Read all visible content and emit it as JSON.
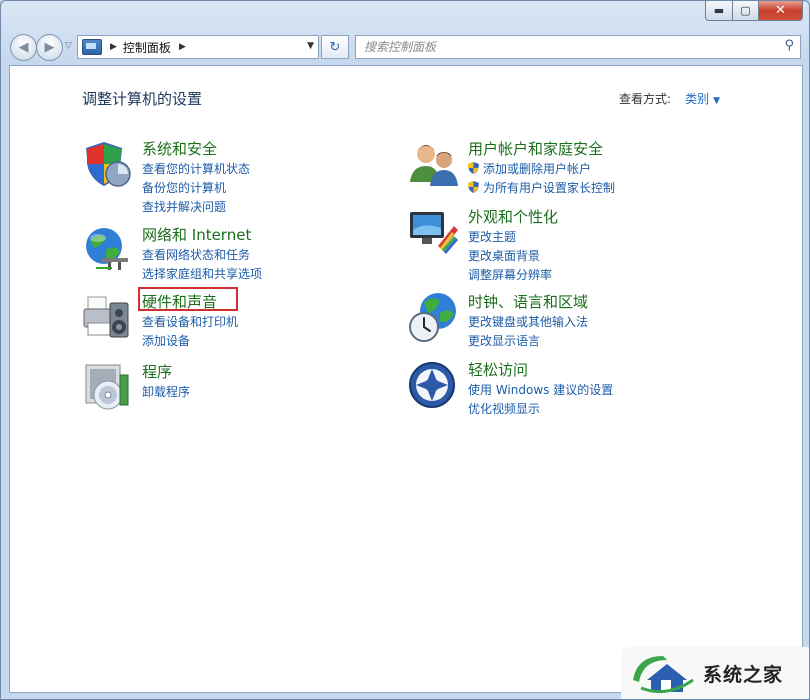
{
  "window": {
    "minimize_label": "▬",
    "maximize_label": "▢",
    "close_label": "✕"
  },
  "nav": {
    "address_crumb": "控制面板",
    "search_placeholder": "搜索控制面板"
  },
  "header": {
    "title": "调整计算机的设置",
    "view_by_label": "查看方式:",
    "view_by_value": "类别"
  },
  "categories_left": [
    {
      "title": "系统和安全",
      "icon": "shield-icon",
      "links": [
        "查看您的计算机状态",
        "备份您的计算机",
        "查找并解决问题"
      ]
    },
    {
      "title": "网络和 Internet",
      "icon": "network-globe-icon",
      "links": [
        "查看网络状态和任务",
        "选择家庭组和共享选项"
      ]
    },
    {
      "title": "硬件和声音",
      "icon": "printer-speaker-icon",
      "links": [
        "查看设备和打印机",
        "添加设备"
      ]
    },
    {
      "title": "程序",
      "icon": "programs-disc-icon",
      "links": [
        "卸载程序"
      ]
    }
  ],
  "categories_right": [
    {
      "title": "用户帐户和家庭安全",
      "icon": "users-icon",
      "links": [
        "添加或删除用户帐户",
        "为所有用户设置家长控制"
      ]
    },
    {
      "title": "外观和个性化",
      "icon": "monitor-paint-icon",
      "links": [
        "更改主题",
        "更改桌面背景",
        "调整屏幕分辨率"
      ]
    },
    {
      "title": "时钟、语言和区域",
      "icon": "clock-globe-icon",
      "links": [
        "更改键盘或其他输入法",
        "更改显示语言"
      ]
    },
    {
      "title": "轻松访问",
      "icon": "ease-of-access-icon",
      "links": [
        "使用 Windows 建议的设置",
        "优化视频显示"
      ]
    }
  ],
  "highlighted_category": "硬件和声音",
  "watermark": {
    "text": "系统之家"
  },
  "colors": {
    "heading_green": "#1b6f1b",
    "link_blue": "#1c5ca8",
    "highlight_red": "#d03030"
  }
}
